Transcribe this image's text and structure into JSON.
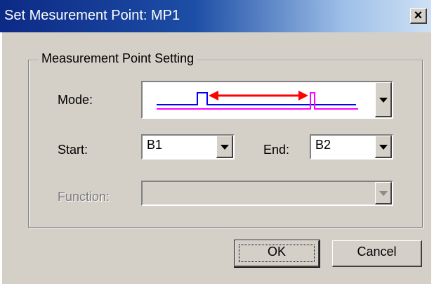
{
  "dialog": {
    "title": "Set Mesurement Point: MP1",
    "close_glyph": "×",
    "group_label": "Measurement Point Setting",
    "mode": {
      "label": "Mode:",
      "selected_icon": "pulse-width-between-edges-icon",
      "colors": {
        "upper_line": "#0000ff",
        "lower_line": "#ff00ff",
        "arrow": "#ff0000"
      }
    },
    "start": {
      "label": "Start:",
      "value": "B1"
    },
    "end": {
      "label": "End:",
      "value": "B2"
    },
    "function": {
      "label": "Function:",
      "value": ""
    },
    "buttons": {
      "ok": "OK",
      "cancel": "Cancel"
    }
  }
}
